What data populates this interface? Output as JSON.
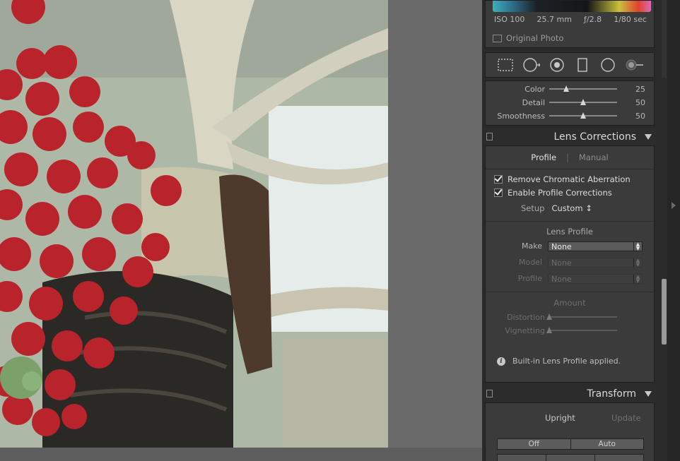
{
  "exif": {
    "iso": "ISO 100",
    "focal": "25.7 mm",
    "aperture": "ƒ/2.8",
    "shutter": "1/80 sec"
  },
  "original_photo_label": "Original Photo",
  "tools": [
    "crop-overlay-icon",
    "spot-removal-icon",
    "red-eye-icon",
    "graduated-filter-icon",
    "radial-filter-icon",
    "adjustment-brush-icon"
  ],
  "noise_reduction": {
    "sliders": [
      {
        "label": "Color",
        "value": "25",
        "fraction": 0.25
      },
      {
        "label": "Detail",
        "value": "50",
        "fraction": 0.5
      },
      {
        "label": "Smoothness",
        "value": "50",
        "fraction": 0.5
      }
    ]
  },
  "lens_corrections": {
    "title": "Lens Corrections",
    "tabs": {
      "profile": "Profile",
      "manual": "Manual",
      "separator": "|"
    },
    "remove_ca": "Remove Chromatic Aberration",
    "enable_profile": "Enable Profile Corrections",
    "setup": {
      "label": "Setup",
      "value": "Custom",
      "arrows": "↕"
    },
    "lens_profile_heading": "Lens Profile",
    "make": {
      "label": "Make",
      "value": "None"
    },
    "model": {
      "label": "Model",
      "value": "None"
    },
    "profile": {
      "label": "Profile",
      "value": "None"
    },
    "amount_heading": "Amount",
    "distortion": {
      "label": "Distortion",
      "fraction": 0.0
    },
    "vignetting": {
      "label": "Vignetting",
      "fraction": 0.0
    },
    "info_text": "Built-in Lens Profile applied."
  },
  "transform": {
    "title": "Transform",
    "upright_label": "Upright",
    "update_label": "Update",
    "off_label": "Off",
    "auto_label": "Auto"
  }
}
